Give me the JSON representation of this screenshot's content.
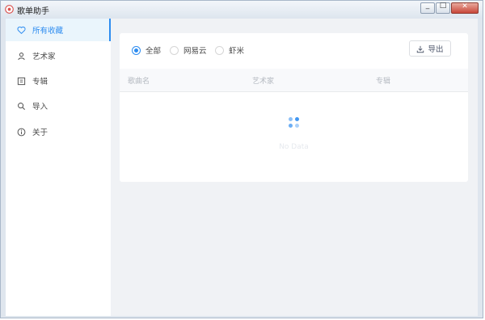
{
  "window": {
    "title": "歌单助手"
  },
  "sidebar": {
    "items": [
      {
        "label": "所有收藏",
        "icon": "heart-icon",
        "active": true
      },
      {
        "label": "艺术家",
        "icon": "person-icon",
        "active": false
      },
      {
        "label": "专辑",
        "icon": "album-icon",
        "active": false
      },
      {
        "label": "导入",
        "icon": "search-icon",
        "active": false
      },
      {
        "label": "关于",
        "icon": "info-icon",
        "active": false
      }
    ]
  },
  "filters": {
    "options": [
      "全部",
      "网易云",
      "虾米"
    ],
    "selected": "全部"
  },
  "toolbar": {
    "export_label": "导出"
  },
  "table": {
    "columns": [
      "歌曲名",
      "艺术家",
      "专辑"
    ],
    "empty_text": "No Data"
  },
  "colors": {
    "accent": "#2d8cf0"
  }
}
